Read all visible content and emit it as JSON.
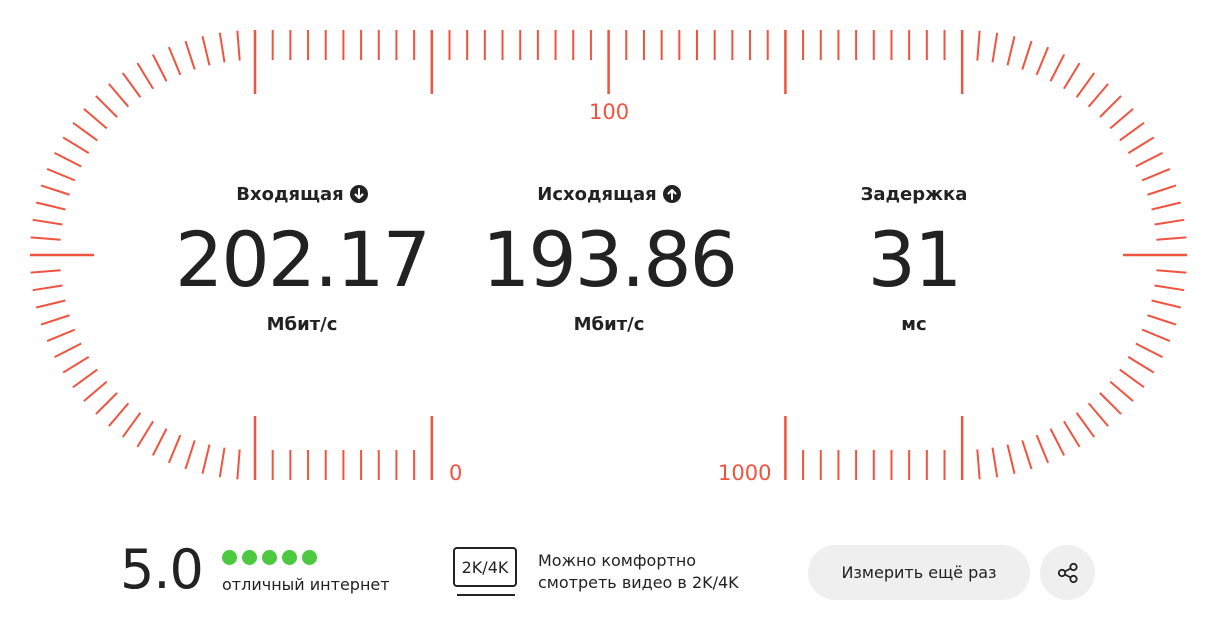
{
  "gauge": {
    "accent_color": "#f0533f",
    "scale_labels": {
      "top": "100",
      "bottom_left": "0",
      "bottom_right": "1000"
    }
  },
  "metrics": {
    "download": {
      "label": "Входящая",
      "value": "202.17",
      "unit": "Мбит/с",
      "icon": "arrow-down-icon"
    },
    "upload": {
      "label": "Исходящая",
      "value": "193.86",
      "unit": "Мбит/с",
      "icon": "arrow-up-icon"
    },
    "latency": {
      "label": "Задержка",
      "value": "31",
      "unit": "мс"
    }
  },
  "rating": {
    "score": "5.0",
    "stars_filled": 5,
    "stars_total": 5,
    "color": "#4cc940",
    "text": "отличный интернет"
  },
  "quality": {
    "badge": "2K/4K",
    "line1": "Можно комфортно",
    "line2": "смотреть видео в 2K/4K"
  },
  "actions": {
    "retest_label": "Измерить ещё раз",
    "share_icon": "share-icon"
  }
}
